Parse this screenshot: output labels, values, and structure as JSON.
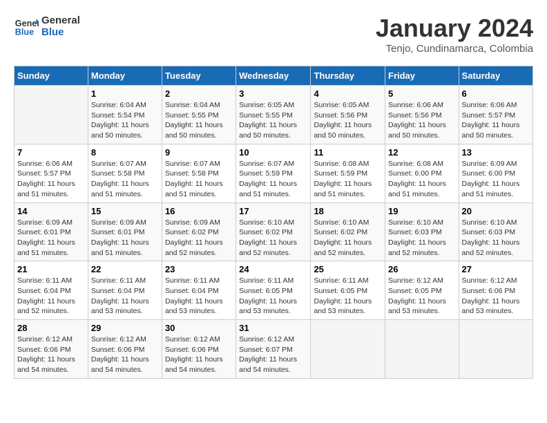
{
  "header": {
    "logo_line1": "General",
    "logo_line2": "Blue",
    "month": "January 2024",
    "location": "Tenjo, Cundinamarca, Colombia"
  },
  "weekdays": [
    "Sunday",
    "Monday",
    "Tuesday",
    "Wednesday",
    "Thursday",
    "Friday",
    "Saturday"
  ],
  "weeks": [
    [
      {
        "day": "",
        "sunrise": "",
        "sunset": "",
        "daylight": ""
      },
      {
        "day": "1",
        "sunrise": "Sunrise: 6:04 AM",
        "sunset": "Sunset: 5:54 PM",
        "daylight": "Daylight: 11 hours and 50 minutes."
      },
      {
        "day": "2",
        "sunrise": "Sunrise: 6:04 AM",
        "sunset": "Sunset: 5:55 PM",
        "daylight": "Daylight: 11 hours and 50 minutes."
      },
      {
        "day": "3",
        "sunrise": "Sunrise: 6:05 AM",
        "sunset": "Sunset: 5:55 PM",
        "daylight": "Daylight: 11 hours and 50 minutes."
      },
      {
        "day": "4",
        "sunrise": "Sunrise: 6:05 AM",
        "sunset": "Sunset: 5:56 PM",
        "daylight": "Daylight: 11 hours and 50 minutes."
      },
      {
        "day": "5",
        "sunrise": "Sunrise: 6:06 AM",
        "sunset": "Sunset: 5:56 PM",
        "daylight": "Daylight: 11 hours and 50 minutes."
      },
      {
        "day": "6",
        "sunrise": "Sunrise: 6:06 AM",
        "sunset": "Sunset: 5:57 PM",
        "daylight": "Daylight: 11 hours and 50 minutes."
      }
    ],
    [
      {
        "day": "7",
        "sunrise": "Sunrise: 6:06 AM",
        "sunset": "Sunset: 5:57 PM",
        "daylight": "Daylight: 11 hours and 51 minutes."
      },
      {
        "day": "8",
        "sunrise": "Sunrise: 6:07 AM",
        "sunset": "Sunset: 5:58 PM",
        "daylight": "Daylight: 11 hours and 51 minutes."
      },
      {
        "day": "9",
        "sunrise": "Sunrise: 6:07 AM",
        "sunset": "Sunset: 5:58 PM",
        "daylight": "Daylight: 11 hours and 51 minutes."
      },
      {
        "day": "10",
        "sunrise": "Sunrise: 6:07 AM",
        "sunset": "Sunset: 5:59 PM",
        "daylight": "Daylight: 11 hours and 51 minutes."
      },
      {
        "day": "11",
        "sunrise": "Sunrise: 6:08 AM",
        "sunset": "Sunset: 5:59 PM",
        "daylight": "Daylight: 11 hours and 51 minutes."
      },
      {
        "day": "12",
        "sunrise": "Sunrise: 6:08 AM",
        "sunset": "Sunset: 6:00 PM",
        "daylight": "Daylight: 11 hours and 51 minutes."
      },
      {
        "day": "13",
        "sunrise": "Sunrise: 6:09 AM",
        "sunset": "Sunset: 6:00 PM",
        "daylight": "Daylight: 11 hours and 51 minutes."
      }
    ],
    [
      {
        "day": "14",
        "sunrise": "Sunrise: 6:09 AM",
        "sunset": "Sunset: 6:01 PM",
        "daylight": "Daylight: 11 hours and 51 minutes."
      },
      {
        "day": "15",
        "sunrise": "Sunrise: 6:09 AM",
        "sunset": "Sunset: 6:01 PM",
        "daylight": "Daylight: 11 hours and 51 minutes."
      },
      {
        "day": "16",
        "sunrise": "Sunrise: 6:09 AM",
        "sunset": "Sunset: 6:02 PM",
        "daylight": "Daylight: 11 hours and 52 minutes."
      },
      {
        "day": "17",
        "sunrise": "Sunrise: 6:10 AM",
        "sunset": "Sunset: 6:02 PM",
        "daylight": "Daylight: 11 hours and 52 minutes."
      },
      {
        "day": "18",
        "sunrise": "Sunrise: 6:10 AM",
        "sunset": "Sunset: 6:02 PM",
        "daylight": "Daylight: 11 hours and 52 minutes."
      },
      {
        "day": "19",
        "sunrise": "Sunrise: 6:10 AM",
        "sunset": "Sunset: 6:03 PM",
        "daylight": "Daylight: 11 hours and 52 minutes."
      },
      {
        "day": "20",
        "sunrise": "Sunrise: 6:10 AM",
        "sunset": "Sunset: 6:03 PM",
        "daylight": "Daylight: 11 hours and 52 minutes."
      }
    ],
    [
      {
        "day": "21",
        "sunrise": "Sunrise: 6:11 AM",
        "sunset": "Sunset: 6:04 PM",
        "daylight": "Daylight: 11 hours and 52 minutes."
      },
      {
        "day": "22",
        "sunrise": "Sunrise: 6:11 AM",
        "sunset": "Sunset: 6:04 PM",
        "daylight": "Daylight: 11 hours and 53 minutes."
      },
      {
        "day": "23",
        "sunrise": "Sunrise: 6:11 AM",
        "sunset": "Sunset: 6:04 PM",
        "daylight": "Daylight: 11 hours and 53 minutes."
      },
      {
        "day": "24",
        "sunrise": "Sunrise: 6:11 AM",
        "sunset": "Sunset: 6:05 PM",
        "daylight": "Daylight: 11 hours and 53 minutes."
      },
      {
        "day": "25",
        "sunrise": "Sunrise: 6:11 AM",
        "sunset": "Sunset: 6:05 PM",
        "daylight": "Daylight: 11 hours and 53 minutes."
      },
      {
        "day": "26",
        "sunrise": "Sunrise: 6:12 AM",
        "sunset": "Sunset: 6:05 PM",
        "daylight": "Daylight: 11 hours and 53 minutes."
      },
      {
        "day": "27",
        "sunrise": "Sunrise: 6:12 AM",
        "sunset": "Sunset: 6:06 PM",
        "daylight": "Daylight: 11 hours and 53 minutes."
      }
    ],
    [
      {
        "day": "28",
        "sunrise": "Sunrise: 6:12 AM",
        "sunset": "Sunset: 6:06 PM",
        "daylight": "Daylight: 11 hours and 54 minutes."
      },
      {
        "day": "29",
        "sunrise": "Sunrise: 6:12 AM",
        "sunset": "Sunset: 6:06 PM",
        "daylight": "Daylight: 11 hours and 54 minutes."
      },
      {
        "day": "30",
        "sunrise": "Sunrise: 6:12 AM",
        "sunset": "Sunset: 6:06 PM",
        "daylight": "Daylight: 11 hours and 54 minutes."
      },
      {
        "day": "31",
        "sunrise": "Sunrise: 6:12 AM",
        "sunset": "Sunset: 6:07 PM",
        "daylight": "Daylight: 11 hours and 54 minutes."
      },
      {
        "day": "",
        "sunrise": "",
        "sunset": "",
        "daylight": ""
      },
      {
        "day": "",
        "sunrise": "",
        "sunset": "",
        "daylight": ""
      },
      {
        "day": "",
        "sunrise": "",
        "sunset": "",
        "daylight": ""
      }
    ]
  ]
}
